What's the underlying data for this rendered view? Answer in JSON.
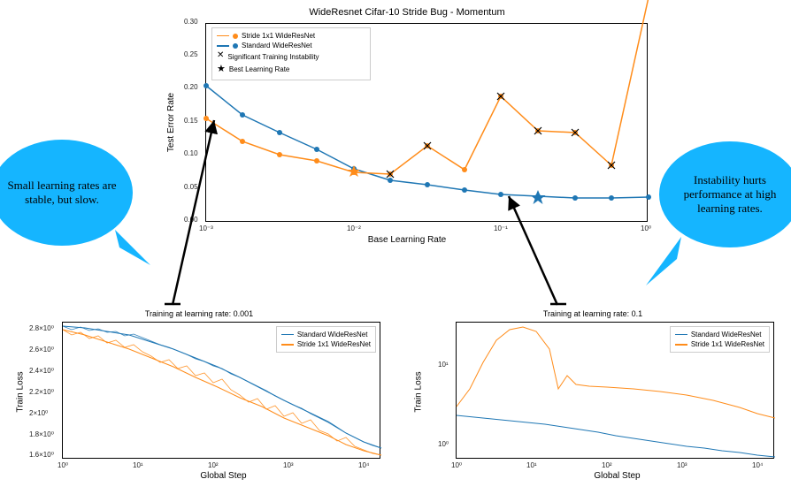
{
  "top": {
    "title": "WideResnet Cifar-10 Stride Bug - Momentum",
    "ylabel": "Test Error Rate",
    "xlabel": "Base Learning Rate",
    "yticks": [
      "0.00",
      "0.05",
      "0.10",
      "0.15",
      "0.20",
      "0.25",
      "0.30"
    ],
    "xticks": [
      "10⁻³",
      "10⁻²",
      "10⁻¹",
      "10⁰"
    ]
  },
  "legend_top": {
    "l1": "Stride 1x1 WideResNet",
    "l2": "Standard WideResNet",
    "l3": "Significant Training Instability",
    "l4": "Best Learning Rate"
  },
  "bubbles": {
    "left": "Small learning rates are stable, but slow.",
    "right": "Instability hurts performance at high learning rates."
  },
  "small": {
    "left_title": "Training at learning rate: 0.001",
    "right_title": "Training at learning rate: 0.1",
    "ylabel": "Train Loss",
    "xlabel": "Global Step",
    "xticks": [
      "10⁰",
      "10¹",
      "10²",
      "10³",
      "10⁴"
    ],
    "left_yticks": [
      "1.6×10⁰",
      "1.8×10⁰",
      "2×10⁰",
      "2.2×10⁰",
      "2.4×10⁰",
      "2.6×10⁰",
      "2.8×10⁰"
    ],
    "right_yticks": [
      "10⁰",
      "10¹"
    ]
  },
  "legend_small": {
    "l1": "Standard WideResNet",
    "l2": "Stride 1x1 WideResNet"
  },
  "chart_data": [
    {
      "type": "line",
      "title": "WideResnet Cifar-10 Stride Bug - Momentum",
      "xlabel": "Base Learning Rate",
      "ylabel": "Test Error Rate",
      "xscale": "log",
      "xlim": [
        0.001,
        1.0
      ],
      "ylim": [
        0.0,
        0.3
      ],
      "x": [
        0.001,
        0.0018,
        0.0032,
        0.0056,
        0.01,
        0.018,
        0.032,
        0.056,
        0.1,
        0.18,
        0.32,
        0.56,
        1.0
      ],
      "series": [
        {
          "name": "Stride 1x1 WideResNet",
          "color": "#ff8c1a",
          "values": [
            0.157,
            0.122,
            0.102,
            0.093,
            0.074,
            0.073,
            0.116,
            0.08,
            0.19,
            0.138,
            0.136,
            0.086,
            0.5
          ],
          "best_x": 0.01,
          "unstable_x": [
            0.018,
            0.032,
            0.1,
            0.18,
            0.32,
            0.56,
            1.0
          ]
        },
        {
          "name": "Standard WideResNet",
          "color": "#1f77b4",
          "values": [
            0.207,
            0.163,
            0.136,
            0.11,
            0.081,
            0.065,
            0.058,
            0.05,
            0.043,
            0.039,
            0.038,
            0.038,
            0.039
          ],
          "best_x": 0.18,
          "unstable_x": []
        }
      ],
      "markers": {
        "x_marker": "Significant Training Instability",
        "star_marker": "Best Learning Rate"
      }
    },
    {
      "type": "line",
      "title": "Training at learning rate: 0.001",
      "xlabel": "Global Step",
      "ylabel": "Train Loss",
      "xscale": "log",
      "yscale": "log",
      "xlim": [
        1,
        20000
      ],
      "ylim": [
        1.55,
        2.85
      ],
      "x": [
        1,
        3,
        10,
        30,
        100,
        300,
        1000,
        3000,
        10000,
        20000
      ],
      "series": [
        {
          "name": "Standard WideResNet",
          "color": "#1f77b4",
          "values": [
            2.8,
            2.78,
            2.74,
            2.68,
            2.58,
            2.44,
            2.26,
            2.05,
            1.82,
            1.66
          ]
        },
        {
          "name": "Stride 1x1 WideResNet",
          "color": "#ff8c1a",
          "values": [
            2.75,
            2.7,
            2.6,
            2.5,
            2.38,
            2.22,
            2.02,
            1.82,
            1.62,
            1.52
          ]
        }
      ]
    },
    {
      "type": "line",
      "title": "Training at learning rate: 0.1",
      "xlabel": "Global Step",
      "ylabel": "Train Loss",
      "xscale": "log",
      "yscale": "log",
      "xlim": [
        1,
        20000
      ],
      "ylim": [
        0.8,
        40
      ],
      "x": [
        1,
        2,
        3,
        5,
        8,
        10,
        15,
        20,
        30,
        50,
        100,
        300,
        1000,
        3000,
        10000,
        20000
      ],
      "series": [
        {
          "name": "Standard WideResNet",
          "color": "#1f77b4",
          "values": [
            2.9,
            2.8,
            2.7,
            2.5,
            2.3,
            2.2,
            2.1,
            2.0,
            1.9,
            1.7,
            1.55,
            1.35,
            1.15,
            1.0,
            0.9,
            0.83
          ]
        },
        {
          "name": "Stride 1x1 WideResNet",
          "color": "#ff8c1a",
          "values": [
            4.0,
            7.0,
            12.0,
            22.0,
            30.0,
            32.0,
            25.0,
            12.0,
            6.5,
            7.5,
            7.0,
            6.5,
            5.5,
            4.5,
            3.2,
            2.4
          ]
        }
      ]
    }
  ]
}
